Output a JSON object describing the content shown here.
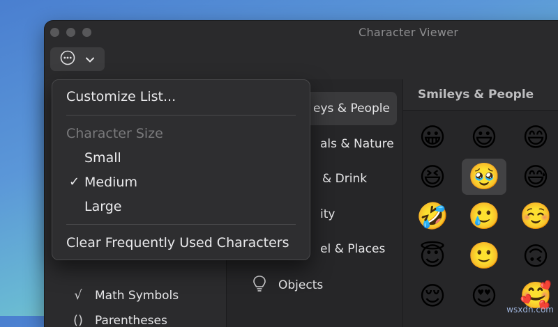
{
  "window": {
    "title": "Character Viewer"
  },
  "toolbar": {
    "action_icon": "ellipsis-circle-icon",
    "dropdown_icon": "chevron-down-icon"
  },
  "menu": {
    "customize": "Customize List...",
    "size_header": "Character Size",
    "sizes": [
      {
        "label": "Small",
        "checked": false
      },
      {
        "label": "Medium",
        "checked": true
      },
      {
        "label": "Large",
        "checked": false
      }
    ],
    "check_mark": "✓",
    "clear": "Clear Frequently Used Characters"
  },
  "sidebar": {
    "items": [
      {
        "symbol": "√",
        "label": "Math Symbols"
      },
      {
        "symbol": "()",
        "label": "Parentheses"
      }
    ]
  },
  "categories": [
    {
      "label": "Smileys & People",
      "visible_text": "eys & People",
      "icon": "smiley-icon",
      "active": true
    },
    {
      "label": "Animals & Nature",
      "visible_text": "als & Nature",
      "icon": "bear-icon",
      "active": false
    },
    {
      "label": "Food & Drink",
      "visible_text": "& Drink",
      "icon": "food-icon",
      "active": false
    },
    {
      "label": "Activity",
      "visible_text": "ity",
      "icon": "ball-icon",
      "active": false
    },
    {
      "label": "Travel & Places",
      "visible_text": "el & Places",
      "icon": "car-icon",
      "active": false
    },
    {
      "label": "Objects",
      "visible_text": "Objects",
      "icon": "lightbulb-icon",
      "active": false
    }
  ],
  "emoji_panel": {
    "title": "Smileys & People",
    "emojis": [
      "😀",
      "😃",
      "😄",
      "😆",
      "🥹",
      "😅",
      "🤣",
      "🥲",
      "☺️",
      "😇",
      "🙂",
      "🙃",
      "😌",
      "😍",
      "🥰"
    ],
    "selected_index": 4
  },
  "watermark": "wsxdn.com"
}
